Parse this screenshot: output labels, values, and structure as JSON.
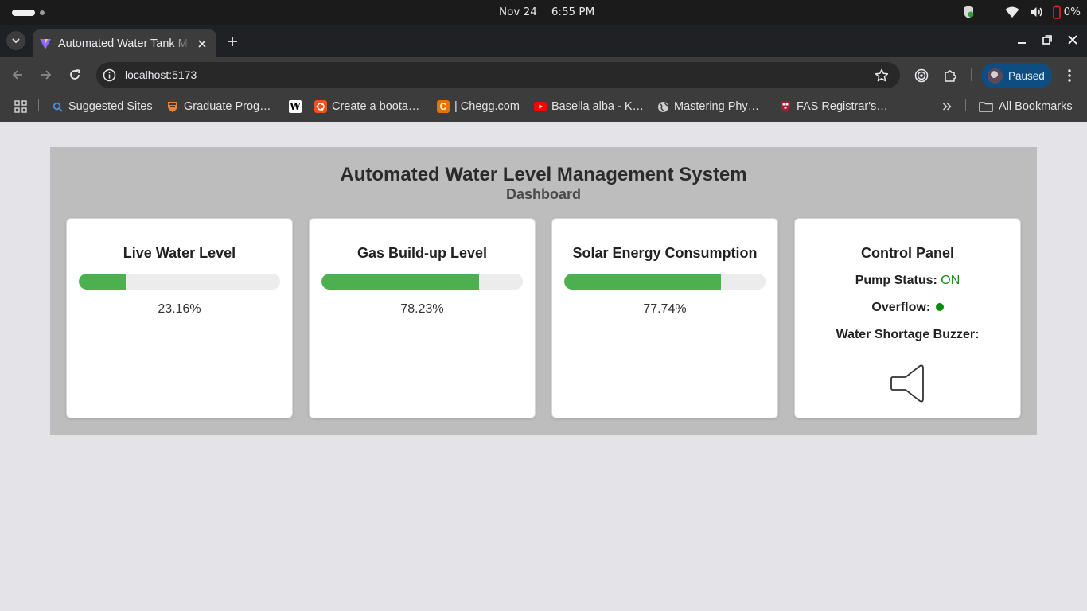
{
  "os_bar": {
    "date": "Nov 24",
    "time": "6:55 PM",
    "battery": "0%"
  },
  "browser": {
    "tab_title": "Automated Water Tank M",
    "url": "localhost:5173",
    "profile_label": "Paused"
  },
  "bookmarks": [
    {
      "label": "Suggested Sites",
      "icon": "search-icon"
    },
    {
      "label": "Graduate Prog…",
      "icon": "princeton-icon"
    },
    {
      "label": "",
      "icon": "wikipedia-icon"
    },
    {
      "label": "Create a boota…",
      "icon": "ubuntu-icon"
    },
    {
      "label": "| Chegg.com",
      "icon": "chegg-icon"
    },
    {
      "label": "Basella alba - K…",
      "icon": "youtube-icon"
    },
    {
      "label": "Mastering Phy…",
      "icon": "globe-icon"
    },
    {
      "label": "FAS Registrar's…",
      "icon": "harvard-icon"
    }
  ],
  "all_bookmarks_label": "All Bookmarks",
  "dashboard": {
    "title": "Automated Water Level Management System",
    "subtitle": "Dashboard",
    "cards": [
      {
        "title": "Live Water Level",
        "percent_label": "23.16%",
        "value": 23.16
      },
      {
        "title": "Gas Build-up Level",
        "percent_label": "78.23%",
        "value": 78.23
      },
      {
        "title": "Solar Energy Consumption",
        "percent_label": "77.74%",
        "value": 77.74
      }
    ],
    "control_panel": {
      "title": "Control Panel",
      "pump_label": "Pump Status:",
      "pump_value": "ON",
      "overflow_label": "Overflow:",
      "buzzer_label": "Water Shortage Buzzer:"
    }
  },
  "colors": {
    "progress_fill": "#4caf50",
    "pump_on": "#1a8a1a",
    "overflow_indicator": "#0a8a0a",
    "profile_chip": "#0e4d82"
  }
}
